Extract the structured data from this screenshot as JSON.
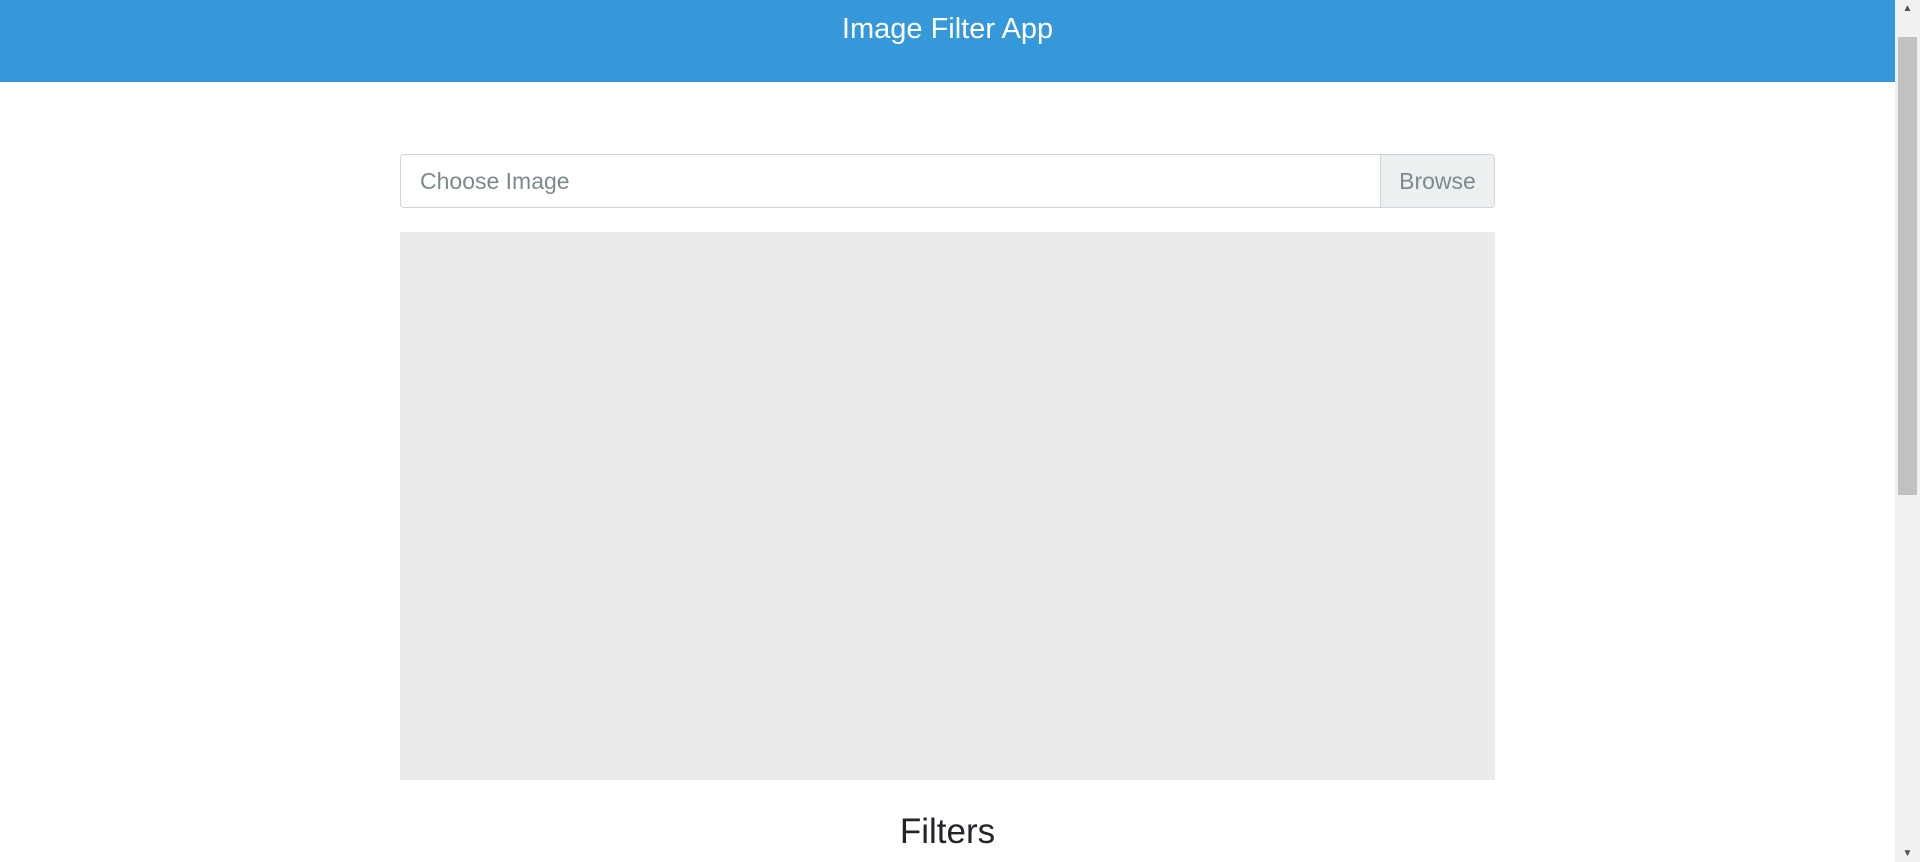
{
  "navbar": {
    "title": "Image Filter App",
    "background_color": "#3498db"
  },
  "file_input": {
    "label": "Choose Image",
    "browse_label": "Browse"
  },
  "preview": {
    "background_color": "#ebebeb"
  },
  "filters": {
    "heading": "Filters"
  },
  "scrollbar": {
    "up_icon": "triangle-up-icon",
    "down_icon": "triangle-down-icon",
    "up_glyph": "▲",
    "down_glyph": "▼"
  }
}
